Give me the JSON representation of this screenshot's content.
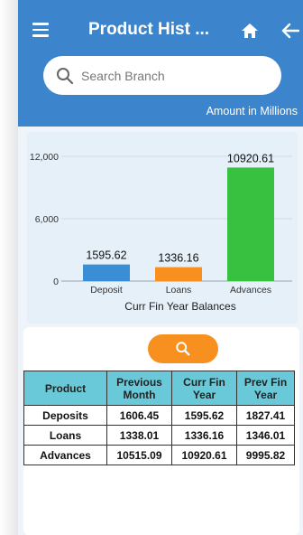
{
  "header": {
    "title": "Product Hist ...",
    "menu_icon": "menu-icon",
    "home_icon": "home-icon",
    "back_icon": "back-arrow-icon",
    "background_color": "#3c85cd"
  },
  "search": {
    "placeholder": "Search Branch",
    "value": ""
  },
  "amount_note": "Amount in Millions",
  "chart_data": {
    "type": "bar",
    "title": "",
    "xlabel": "Curr Fin Year Balances",
    "ylabel": "",
    "categories": [
      "Deposit",
      "Loans",
      "Advances"
    ],
    "values": [
      1595.62,
      1336.16,
      10920.61
    ],
    "value_labels": [
      "1595.62",
      "1336.16",
      "10920.61"
    ],
    "colors": [
      "#3a8ed6",
      "#f7901e",
      "#38c040"
    ],
    "ylim": [
      0,
      12000
    ],
    "yticks": [
      0,
      6000,
      12000
    ],
    "ytick_labels": [
      "0",
      "6,000",
      "12,000"
    ],
    "grid": true,
    "legend": "none"
  },
  "find_button_icon": "search-icon",
  "find_button_color": "#f7901e",
  "table": {
    "header_color": "#6ac9d8",
    "columns": [
      "Product",
      "Previous Month",
      "Curr Fin Year",
      "Prev Fin Year"
    ],
    "rows": [
      [
        "Deposits",
        "1606.45",
        "1595.62",
        "1827.41"
      ],
      [
        "Loans",
        "1338.01",
        "1336.16",
        "1346.01"
      ],
      [
        "Advances",
        "10515.09",
        "10920.61",
        "9995.82"
      ]
    ]
  }
}
